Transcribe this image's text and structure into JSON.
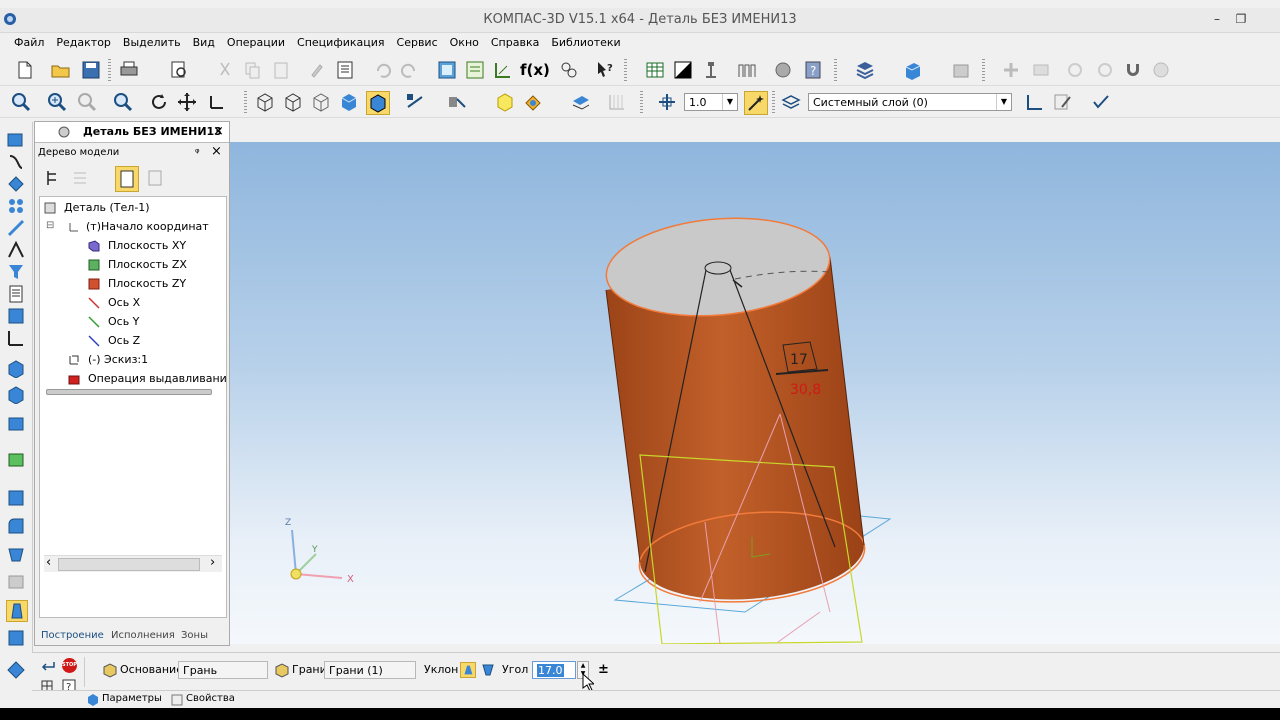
{
  "window": {
    "title": "КОМПАС-3D V15.1 x64 - Деталь БЕЗ ИМЕНИ13",
    "minimize": "–",
    "restore": "❐"
  },
  "menu": [
    "Файл",
    "Редактор",
    "Выделить",
    "Вид",
    "Операции",
    "Спецификация",
    "Сервис",
    "Окно",
    "Справка",
    "Библиотеки"
  ],
  "toolbar": {
    "fx_label": "f(x)",
    "scale_value": "1.0",
    "layer_value": "Системный слой (0)"
  },
  "doc_tab": {
    "title": "Деталь БЕЗ ИМЕНИ13",
    "close": "×"
  },
  "tree_panel": {
    "title": "Дерево модели",
    "pin": "ᵠ",
    "close": "×",
    "items": [
      {
        "label": "Деталь (Тел-1)"
      },
      {
        "label": "(т)Начало координат"
      },
      {
        "label": "Плоскость XY"
      },
      {
        "label": "Плоскость ZX"
      },
      {
        "label": "Плоскость ZY"
      },
      {
        "label": "Ось X"
      },
      {
        "label": "Ось Y"
      },
      {
        "label": "Ось Z"
      },
      {
        "label": "(-) Эскиз:1"
      },
      {
        "label": "Операция выдавливания"
      }
    ],
    "expander": "⊟",
    "scroll_left": "‹",
    "scroll_right": "›",
    "bottom_tabs": [
      "Построение",
      "Исполнения",
      "Зоны"
    ]
  },
  "viewport": {
    "triad": {
      "x": "X",
      "y": "Y",
      "z": "Z"
    },
    "dimension_label": "17",
    "dimension_value": "30,8"
  },
  "property_bar": {
    "base_button": "Основание",
    "base_field": "Грань",
    "faces_button": "Грани",
    "faces_field": "Грани (1)",
    "slope_label": "Уклон",
    "angle_label": "Угол",
    "angle_value": "17.0",
    "plusminus": "±",
    "stop_label": "STOP",
    "tab_params": "Параметры",
    "tab_props": "Свойства"
  },
  "colors": {
    "cylinder": "#b8541e",
    "cylinder_edge": "#f27a3a",
    "top_face": "#c9c9c9",
    "viewport_top": "#8fb6dd",
    "viewport_bottom": "#f4f8fc",
    "sketch_green": "#c8d62a",
    "sketch_blue": "#5aa8d8",
    "dim_red": "#d01818"
  }
}
